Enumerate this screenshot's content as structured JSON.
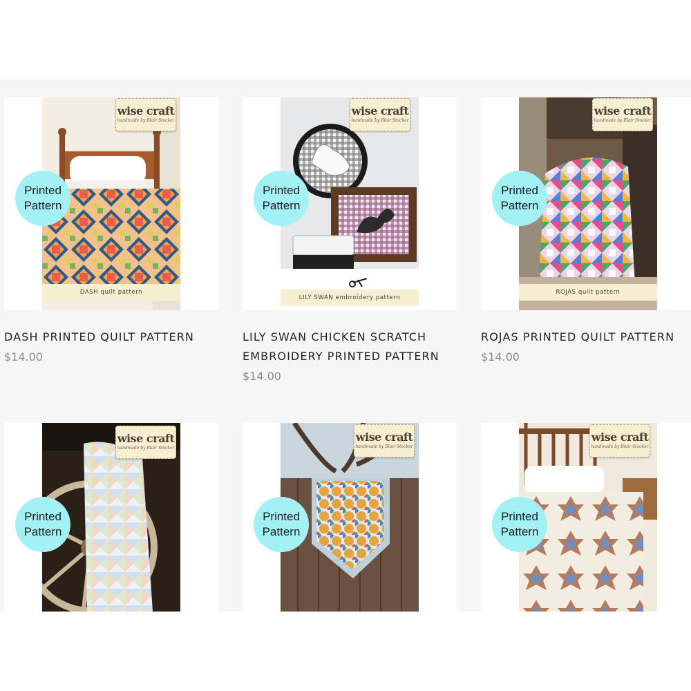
{
  "brand": {
    "logo_text": "wise craft",
    "logo_sub": "handmade by Blair Stocker"
  },
  "badge": {
    "line1": "Printed",
    "line2": "Pattern"
  },
  "products": [
    {
      "title": "DASH PRINTED QUILT PATTERN",
      "price": "$14.00",
      "cover_caption": "DASH quilt pattern"
    },
    {
      "title": "LILY SWAN CHICKEN SCRATCH EMBROIDERY PRINTED PATTERN",
      "price": "$14.00",
      "cover_caption": "LILY SWAN embroidery pattern"
    },
    {
      "title": "ROJAS PRINTED QUILT PATTERN",
      "price": "$14.00",
      "cover_caption": "ROJAS quilt pattern"
    },
    {
      "title": "",
      "price": "",
      "cover_caption": ""
    },
    {
      "title": "",
      "price": "",
      "cover_caption": ""
    },
    {
      "title": "",
      "price": "",
      "cover_caption": ""
    }
  ],
  "colors": {
    "badge": "#a3f1f5",
    "logo_bg": "#f7efd2",
    "price": "#8a8a8a",
    "band": "#f6f6f6"
  }
}
